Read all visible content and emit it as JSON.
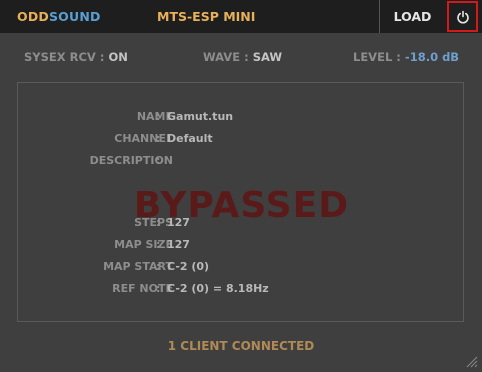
{
  "header": {
    "brand_part1": "ODD",
    "brand_part2": "SOUND",
    "title": "MTS-ESP MINI",
    "load_label": "LOAD",
    "power_icon": "power-icon"
  },
  "status": {
    "sysex_label": "SYSEX RCV",
    "sysex_value": "ON",
    "wave_label": "WAVE",
    "wave_value": "SAW",
    "level_label": "LEVEL",
    "level_value": "-18.0 dB"
  },
  "details": {
    "name_label": "NAME",
    "name_value": "Gamut.tun",
    "channel_label": "CHANNEL",
    "channel_value": "Default",
    "description_label": "DESCRIPTION",
    "description_value": "",
    "steps_label": "STEPS",
    "steps_value": "127",
    "map_size_label": "MAP SIZE",
    "map_size_value": "127",
    "map_start_label": "MAP START",
    "map_start_value": "C-2 (0)",
    "ref_note_label": "REF NOTE",
    "ref_note_value": "C-2 (0) = 8.18Hz",
    "separator": ":"
  },
  "overlay": {
    "text": "BYPASSED"
  },
  "footer": {
    "text": "1 CLIENT CONNECTED"
  },
  "colors": {
    "accent_orange": "#e8b05a",
    "accent_blue": "#5a9fd4",
    "power_border": "#d11b1b",
    "bypassed": "#5a1a1a"
  }
}
